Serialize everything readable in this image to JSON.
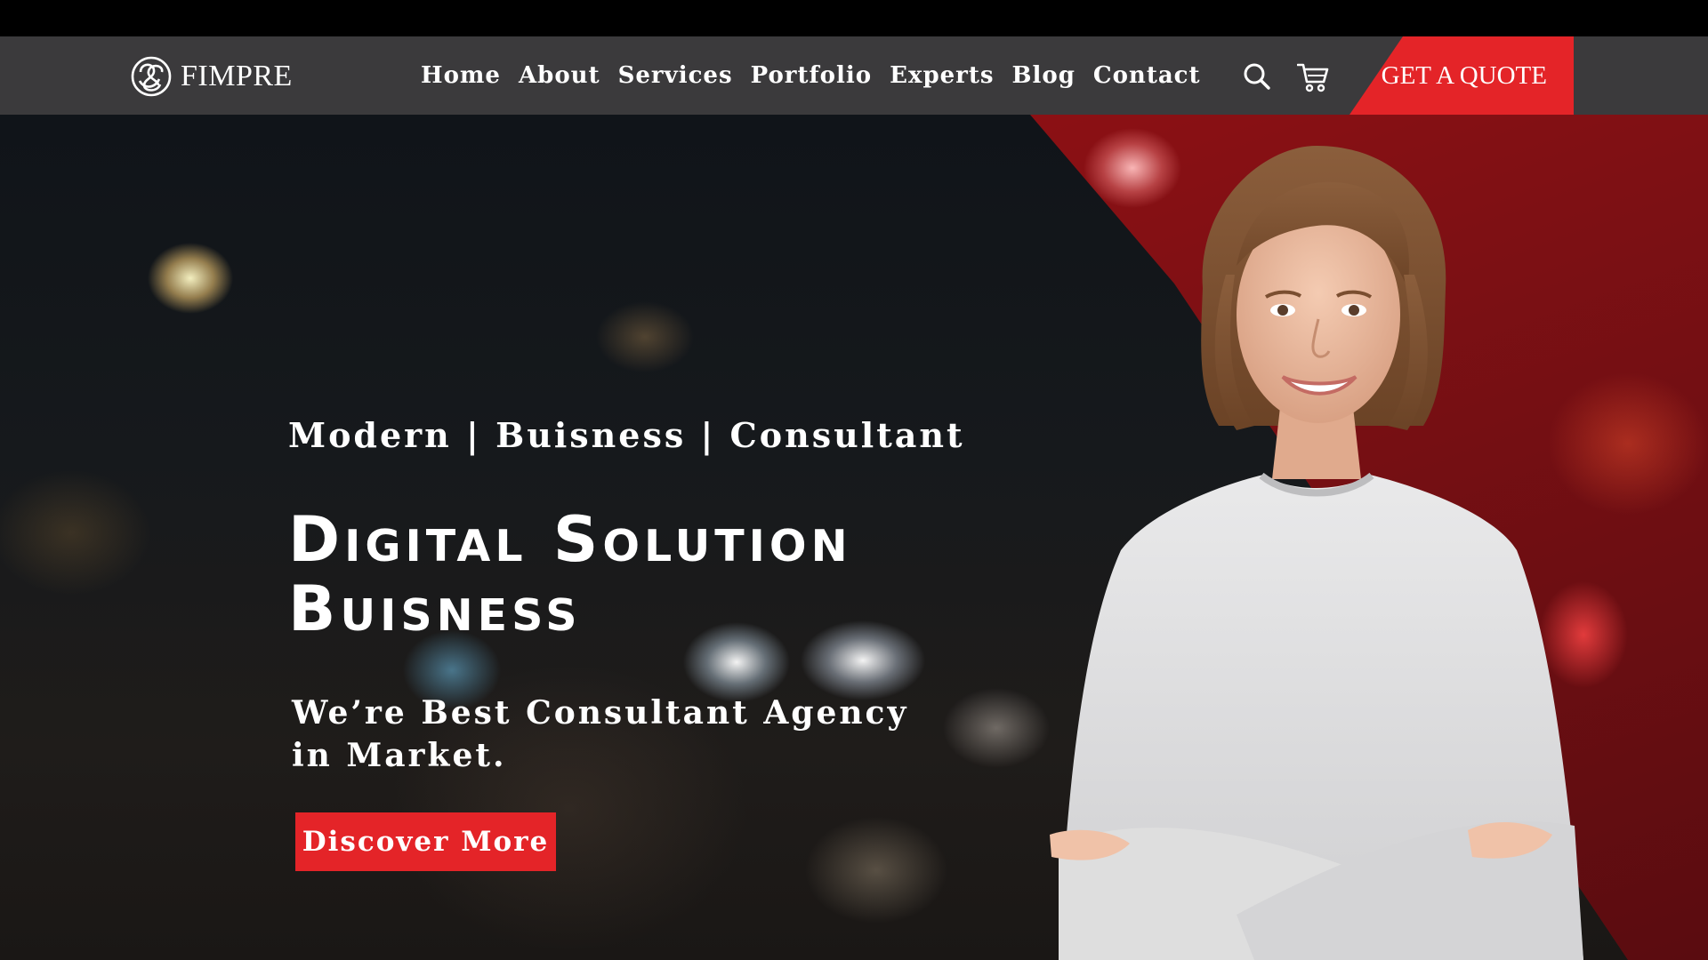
{
  "brand": {
    "name": "FIMPRE",
    "logo_icon": "flower-knot-icon"
  },
  "nav": {
    "items": [
      {
        "label": "Home"
      },
      {
        "label": "About"
      },
      {
        "label": "Services"
      },
      {
        "label": "Portfolio"
      },
      {
        "label": "Experts"
      },
      {
        "label": "Blog"
      },
      {
        "label": "Contact"
      }
    ],
    "search_icon": "search-icon",
    "cart_icon": "cart-icon",
    "quote_label": "GET A QUOTE"
  },
  "hero": {
    "tagline": "Modern | Buisness | Consultant",
    "headline_line1": "Digital Solution",
    "headline_line2": "Buisness",
    "subline": "We’re Best Consultant Agency in Market.",
    "cta_label": "Discover More"
  },
  "colors": {
    "accent": "#e42428",
    "navbar": "#3b3a3c",
    "red_panel": "#8a1014"
  }
}
